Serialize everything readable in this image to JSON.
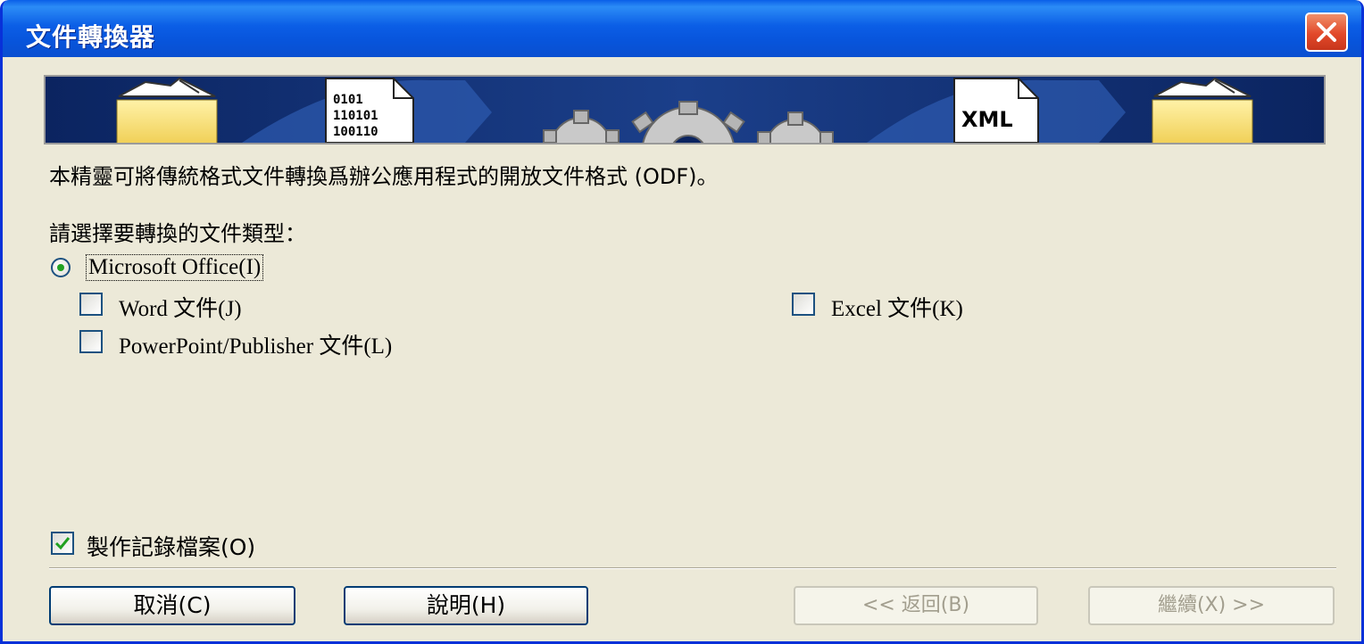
{
  "window": {
    "title": "文件轉換器"
  },
  "banner": {
    "binary_lines": [
      "0101",
      "110101",
      "100110"
    ],
    "xml_label": "XML"
  },
  "content": {
    "description": "本精靈可將傳統格式文件轉換爲辦公應用程式的開放文件格式 (ODF)。",
    "prompt": "請選擇要轉換的文件類型："
  },
  "options": {
    "office_radio": {
      "label": "Microsoft Office(I)",
      "selected": true
    },
    "word": {
      "label": "Word 文件(J)",
      "checked": false
    },
    "excel": {
      "label": "Excel 文件(K)",
      "checked": false
    },
    "powerpoint": {
      "label": "PowerPoint/Publisher 文件(L)",
      "checked": false
    },
    "log_file": {
      "label": "製作記錄檔案(O)",
      "checked": true
    }
  },
  "buttons": {
    "cancel": "取消(C)",
    "help": "說明(H)",
    "back": "<< 返回(B)",
    "next": "繼續(X) >>"
  },
  "colors": {
    "title_bar": "#0a5fe8",
    "dialog_bg": "#ece9d8",
    "close_button": "#e2492a",
    "radio_dot": "#21a121",
    "checkmark": "#21a121"
  },
  "icons": [
    "close-icon",
    "folder-icon",
    "binary-document-icon",
    "gear-icon",
    "xml-document-icon",
    "arrow-icon",
    "checkmark-icon"
  ]
}
